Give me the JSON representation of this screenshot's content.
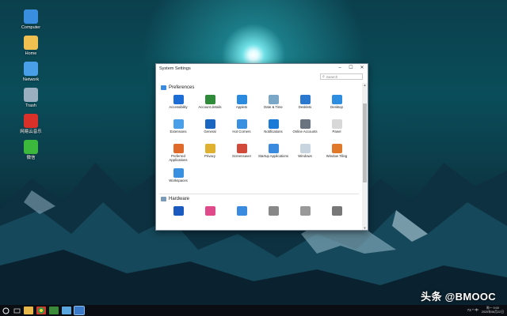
{
  "desktop": {
    "icons": [
      {
        "label": "Computer",
        "icon": "computer-icon",
        "color": "#3a8ee0"
      },
      {
        "label": "Home",
        "icon": "folder-icon",
        "color": "#f0c050"
      },
      {
        "label": "Network",
        "icon": "network-icon",
        "color": "#4aa0e8"
      },
      {
        "label": "Trash",
        "icon": "trash-icon",
        "color": "#9ab0c0"
      },
      {
        "label": "网易云音乐",
        "icon": "netease-music-icon",
        "color": "#d9302a"
      },
      {
        "label": "微信",
        "icon": "wechat-icon",
        "color": "#3cb83c"
      }
    ]
  },
  "window": {
    "title": "System Settings",
    "controls": {
      "minimize": "–",
      "maximize": "☐",
      "close": "✕"
    },
    "search": {
      "placeholder": "Search"
    },
    "sections": [
      {
        "title": "Preferences",
        "icon": "preferences-icon",
        "items": [
          {
            "label": "Accessibility",
            "icon": "accessibility-icon",
            "color": "#1c6ed6"
          },
          {
            "label": "Account details",
            "icon": "account-details-icon",
            "color": "#2f8a3a"
          },
          {
            "label": "Applets",
            "icon": "applets-icon",
            "color": "#2a8ae0"
          },
          {
            "label": "Date & Time",
            "icon": "date-time-icon",
            "color": "#7aa6c8"
          },
          {
            "label": "Desklets",
            "icon": "desklets-icon",
            "color": "#2a78d0"
          },
          {
            "label": "Desktop",
            "icon": "desktop-icon",
            "color": "#2d8de0"
          },
          {
            "label": "Extensions",
            "icon": "extensions-icon",
            "color": "#4aa0e8"
          },
          {
            "label": "General",
            "icon": "general-icon",
            "color": "#1a66c0"
          },
          {
            "label": "Hot Corners",
            "icon": "hot-corners-icon",
            "color": "#3a90e0"
          },
          {
            "label": "Notifications",
            "icon": "notifications-icon",
            "color": "#1a7ad8"
          },
          {
            "label": "Online Accounts",
            "icon": "online-accounts-icon",
            "color": "#6a7480"
          },
          {
            "label": "Panel",
            "icon": "panel-icon",
            "color": "#d8d8d8"
          },
          {
            "label": "Preferred Applications",
            "icon": "preferred-applications-icon",
            "color": "#e06a2a"
          },
          {
            "label": "Privacy",
            "icon": "privacy-icon",
            "color": "#e0b030"
          },
          {
            "label": "Screensaver",
            "icon": "screensaver-icon",
            "color": "#d24a3a"
          },
          {
            "label": "Startup Applications",
            "icon": "startup-applications-icon",
            "color": "#3a8ae0"
          },
          {
            "label": "Windows",
            "icon": "windows-icon",
            "color": "#c8d4e0"
          },
          {
            "label": "Window Tiling",
            "icon": "window-tiling-icon",
            "color": "#e07a2a"
          },
          {
            "label": "Workspaces",
            "icon": "workspaces-icon",
            "color": "#3a90e0"
          }
        ]
      },
      {
        "title": "Hardware",
        "icon": "hardware-icon",
        "items": [
          {
            "label": "",
            "icon": "bluetooth-icon",
            "color": "#1a5ac0"
          },
          {
            "label": "",
            "icon": "color-icon",
            "color": "#e04a8a"
          },
          {
            "label": "",
            "icon": "display-icon",
            "color": "#3a8ae0"
          },
          {
            "label": "",
            "icon": "drivers-icon",
            "color": "#888888"
          },
          {
            "label": "",
            "icon": "firmware-icon",
            "color": "#999999"
          },
          {
            "label": "",
            "icon": "graphics-icon",
            "color": "#777777"
          }
        ]
      }
    ]
  },
  "taskbar": {
    "tray_text": "73 ^ 中",
    "clock_time": "周一 9:00",
    "clock_date": "2020年06月22日"
  },
  "watermark": "头条 @BMOOC"
}
